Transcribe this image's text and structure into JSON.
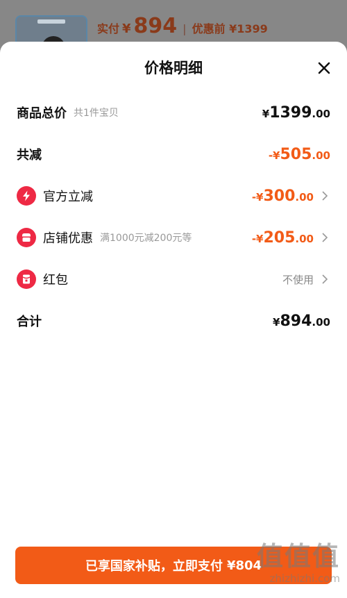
{
  "background": {
    "price_label": "实付",
    "price_yen": "¥",
    "price_value": "894",
    "separator": "|",
    "before_label": "优惠前 ¥1399"
  },
  "sheet": {
    "title": "价格明细",
    "close_icon": "close-icon"
  },
  "rows": {
    "total": {
      "label": "商品总价",
      "sub": "共1件宝贝",
      "yen": "¥",
      "int": "1399",
      "dec": ".00"
    },
    "reduction": {
      "label": "共减",
      "yen": "-¥",
      "int": "505",
      "dec": ".00"
    },
    "official": {
      "label": "官方立减",
      "icon": "lightning-icon",
      "yen": "-¥",
      "int": "300",
      "dec": ".00"
    },
    "store": {
      "label": "店铺优惠",
      "icon": "store-icon",
      "sub": "满1000元减200元等",
      "yen": "-¥",
      "int": "205",
      "dec": ".00"
    },
    "redpacket": {
      "label": "红包",
      "icon": "red-packet-icon",
      "value": "不使用"
    },
    "sum": {
      "label": "合计",
      "yen": "¥",
      "int": "894",
      "dec": ".00"
    }
  },
  "footer": {
    "button_label": "已享国家补贴，立即支付",
    "button_amount": "¥804",
    "watermark_big": "值值值",
    "watermark_small": "zhizhizhi.com"
  },
  "colors": {
    "accent": "#f25b17",
    "icon_red": "#ee2944"
  }
}
